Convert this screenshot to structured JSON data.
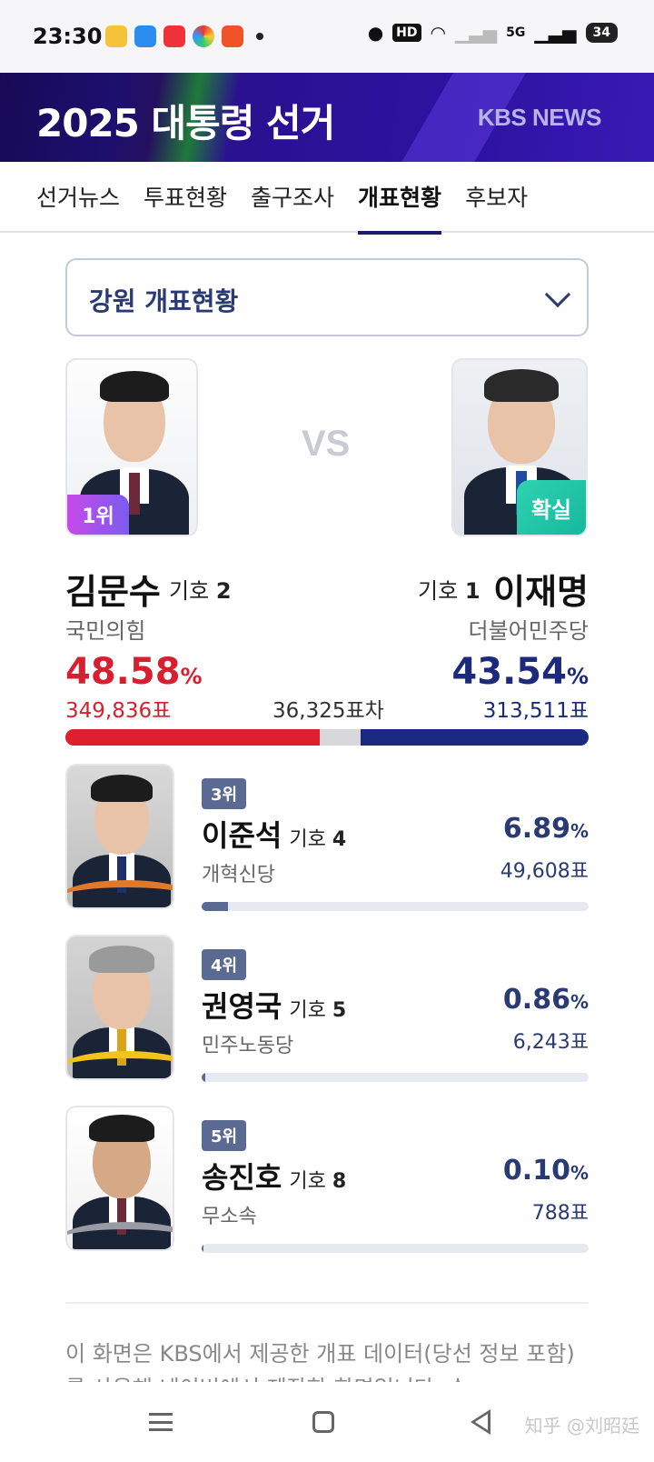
{
  "status_bar": {
    "time": "23:30",
    "hd": "HD",
    "network": "5G",
    "battery": "34",
    "icons": [
      "weibo-icon",
      "bubble-icon",
      "xiaohongshu-icon",
      "browser-icon",
      "video-icon",
      "location-icon",
      "wifi-icon",
      "signal-icon"
    ]
  },
  "banner": {
    "title": "2025 대통령 선거",
    "logo": "KBS NEWS"
  },
  "tabs": [
    "선거뉴스",
    "투표현황",
    "출구조사",
    "개표현황",
    "후보자"
  ],
  "active_tab": "개표현황",
  "region_select": {
    "selected": "강원 개표현황"
  },
  "vs_label": "VS",
  "leader": {
    "rank_badge": "1위",
    "name": "김문수",
    "number_label": "기호",
    "number": "2",
    "party": "국민의힘",
    "percent": "48.58",
    "votes": "349,836표",
    "color": "#d71f30",
    "share": 0.4858
  },
  "runner_up": {
    "status_badge": "확실",
    "name": "이재명",
    "number_label": "기호",
    "number": "1",
    "party": "더불어민주당",
    "percent": "43.54",
    "votes": "313,511표",
    "color": "#1b2a7a",
    "share": 0.4354
  },
  "margin_text": "36,325표차",
  "percent_sign": "%",
  "others": [
    {
      "rank": "3위",
      "name": "이준석",
      "number_label": "기호",
      "number": "4",
      "party": "개혁신당",
      "percent": "6.89",
      "votes": "49,608표",
      "share": 0.0689,
      "accent": "#e07a2a"
    },
    {
      "rank": "4위",
      "name": "권영국",
      "number_label": "기호",
      "number": "5",
      "party": "민주노동당",
      "percent": "0.86",
      "votes": "6,243표",
      "share": 0.0086,
      "accent": "#f2c31a"
    },
    {
      "rank": "5위",
      "name": "송진호",
      "number_label": "기호",
      "number": "8",
      "party": "무소속",
      "percent": "0.10",
      "votes": "788표",
      "share": 0.001,
      "accent": "#9a9aa4"
    }
  ],
  "footnote": "이 화면은 KBS에서 제공한 개표 데이터(당선 정보 포함)를 사용해 네이버에서 제작한 화면입니다. 수",
  "watermark": "知乎 @刘昭廷"
}
